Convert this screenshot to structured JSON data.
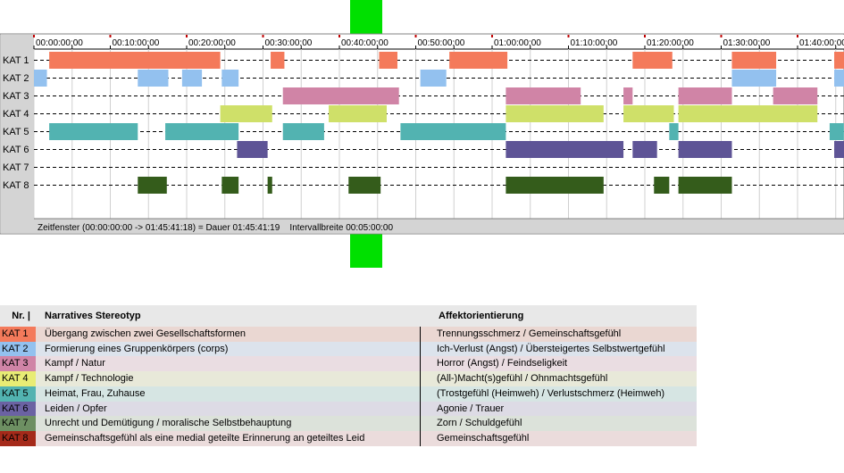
{
  "chart_data": {
    "type": "timeline",
    "title": "",
    "x_unit": "minutes",
    "x_range": [
      0,
      106.5
    ],
    "tick_labels": [
      "00:00:00:00",
      "00:10:00:00",
      "00:20:00:00",
      "00:30:00:00",
      "00:40:00:00",
      "00:50:00:00",
      "01:00:00:00",
      "01:10:00:00",
      "01:20:00:00",
      "01:30:00:00",
      "01:40:00:00"
    ],
    "tick_values": [
      0,
      10,
      20,
      30,
      40,
      50,
      60,
      70,
      80,
      90,
      100
    ],
    "categories": [
      {
        "label": "KAT 1",
        "color": "#f47a5b",
        "segments": [
          [
            2,
            24.4
          ],
          [
            31,
            32.8
          ],
          [
            45.2,
            47.6
          ],
          [
            54.4,
            62
          ],
          [
            78.4,
            83.6
          ],
          [
            91.4,
            97.2
          ],
          [
            104.8,
            106.5
          ]
        ]
      },
      {
        "label": "KAT 2",
        "color": "#93c1ef",
        "segments": [
          [
            0,
            1.7
          ],
          [
            13.6,
            17.6
          ],
          [
            19.4,
            22
          ],
          [
            24.6,
            26.8
          ],
          [
            50.6,
            54
          ],
          [
            91.4,
            97.2
          ],
          [
            104.8,
            106.5
          ]
        ]
      },
      {
        "label": "KAT 3",
        "color": "#d084a6",
        "segments": [
          [
            32.6,
            47.8
          ],
          [
            61.8,
            71.6
          ],
          [
            77.2,
            78.4
          ],
          [
            84.4,
            91.4
          ],
          [
            96.8,
            102.6
          ]
        ]
      },
      {
        "label": "KAT 4",
        "color": "#cfe069",
        "segments": [
          [
            24.4,
            31.2
          ],
          [
            38.6,
            46.2
          ],
          [
            61.8,
            74.6
          ],
          [
            77.2,
            83.8
          ],
          [
            84.4,
            102.6
          ]
        ]
      },
      {
        "label": "KAT 5",
        "color": "#52b3b1",
        "segments": [
          [
            2,
            13.6
          ],
          [
            17.2,
            26.8
          ],
          [
            32.6,
            38
          ],
          [
            48,
            61.8
          ],
          [
            83.2,
            84.4
          ],
          [
            104.2,
            106
          ],
          [
            106,
            106.5
          ]
        ]
      },
      {
        "label": "KAT 6",
        "color": "#5e5496",
        "segments": [
          [
            26.6,
            30.6
          ],
          [
            61.8,
            77.2
          ],
          [
            78.4,
            81.6
          ],
          [
            84.4,
            91.4
          ],
          [
            104.8,
            106.5
          ]
        ]
      },
      {
        "label": "KAT 7",
        "color": "#6a8d5b",
        "segments": []
      },
      {
        "label": "KAT 8",
        "color": "#345c1b",
        "segments": [
          [
            13.6,
            17.4
          ],
          [
            24.6,
            26.8
          ],
          [
            30.6,
            31.2
          ],
          [
            41.2,
            45.4
          ],
          [
            61.8,
            74.6
          ],
          [
            81.2,
            83.2
          ],
          [
            84.4,
            91.4
          ]
        ]
      }
    ]
  },
  "status_bar": "Zeitfenster (00:00:00:00 -> 01:45:41:18) = Dauer 01:45:41:19    Intervallbreite 00:05:00:00",
  "legend": {
    "header": {
      "nr": "Nr. |",
      "stereotyp": "Narratives Stereotyp",
      "affekt": "Affektorientierung"
    },
    "rows": [
      {
        "kat": "KAT 1",
        "color": "#f47a5b",
        "bg": "#ead7d2",
        "stereotyp": "Übergang zwischen zwei Gesellschaftsformen",
        "affekt": "Trennungsschmerz / Gemeinschaftsgefühl"
      },
      {
        "kat": "KAT 2",
        "color": "#93c1ef",
        "bg": "#dce3ec",
        "stereotyp": "Formierung eines Gruppenkörpers (corps)",
        "affekt": "Ich-Verlust (Angst) / Übersteigertes Selbstwertgefühl"
      },
      {
        "kat": "KAT 3",
        "color": "#d084a6",
        "bg": "#eadde2",
        "stereotyp": "Kampf / Natur",
        "affekt": "Horror (Angst) / Feindseligkeit"
      },
      {
        "kat": "KAT 4",
        "color": "#e8ec74",
        "bg": "#e8e9d9",
        "stereotyp": "Kampf / Technologie",
        "affekt": "(All-)Macht(s)gefühl / Ohnmachtsgefühl"
      },
      {
        "kat": "KAT 5",
        "color": "#52b3b1",
        "bg": "#d6e5e3",
        "stereotyp": "Heimat, Frau, Zuhause",
        "affekt": "(Trostgefühl (Heimweh) / Verlustschmerz (Heimweh)"
      },
      {
        "kat": "KAT 6",
        "color": "#6b62a3",
        "bg": "#dddbe5",
        "stereotyp": "Leiden / Opfer",
        "affekt": "Agonie / Trauer"
      },
      {
        "kat": "KAT 7",
        "color": "#6d8f62",
        "bg": "#dce2da",
        "stereotyp": "Unrecht und Demütigung / moralische Selbstbehauptung",
        "affekt": "Zorn / Schuldgefühl"
      },
      {
        "kat": "KAT 8",
        "color": "#a52a1a",
        "bg": "#ebdcdc",
        "stereotyp": "Gemeinschaftsgefühl als eine medial geteilte Erinnerung an geteiltes Leid",
        "affekt": "Gemeinschaftsgefühl"
      }
    ]
  }
}
